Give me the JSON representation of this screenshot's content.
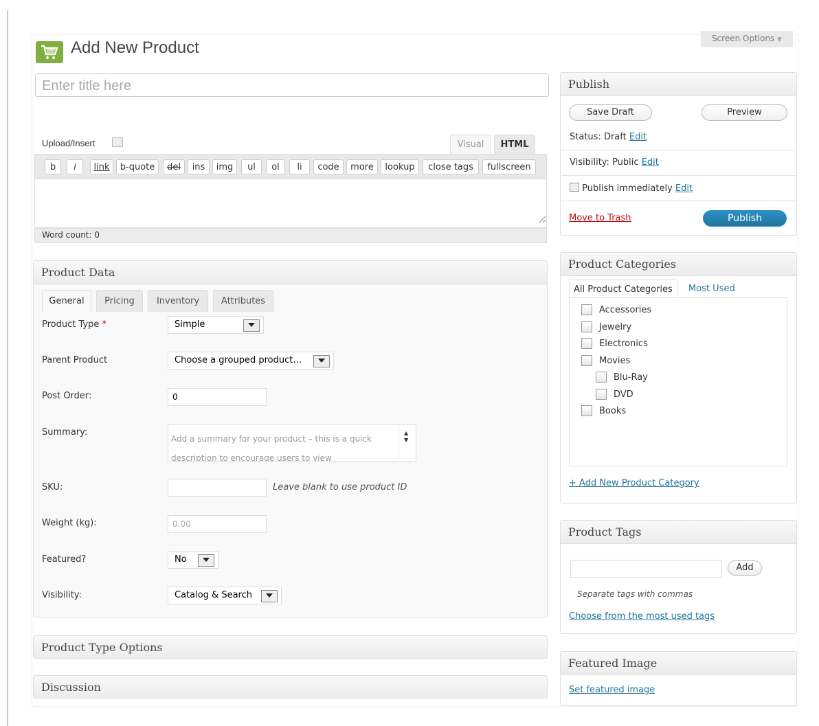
{
  "screen_options": "Screen Options",
  "page_title": "Add New Product",
  "title_placeholder": "Enter title here",
  "editor": {
    "upload_insert": "Upload/Insert",
    "tab_visual": "Visual",
    "tab_html": "HTML",
    "quicktags": [
      "b",
      "i",
      "link",
      "b-quote",
      "del",
      "ins",
      "img",
      "ul",
      "ol",
      "li",
      "code",
      "more",
      "lookup",
      "close tags",
      "fullscreen"
    ],
    "word_count": "Word count: 0"
  },
  "product_data": {
    "title": "Product Data",
    "tabs": [
      "General",
      "Pricing",
      "Inventory",
      "Attributes"
    ],
    "fields": {
      "product_type_label": "Product Type",
      "required_mark": "*",
      "product_type_value": "Simple",
      "parent_product_label": "Parent Product",
      "parent_product_value": "Choose a grouped product…",
      "post_order_label": "Post Order:",
      "post_order_value": "0",
      "summary_label": "Summary:",
      "summary_placeholder": "Add a summary for your product – this is a quick description to encourage users to view",
      "sku_label": "SKU:",
      "sku_value": "",
      "sku_hint": "Leave blank to use product ID",
      "weight_label": "Weight (kg):",
      "weight_placeholder": "0.00",
      "featured_label": "Featured?",
      "featured_value": "No",
      "visibility_label": "Visibility:",
      "visibility_value": "Catalog & Search"
    }
  },
  "product_type_options": "Product Type Options",
  "discussion": "Discussion",
  "publish": {
    "title": "Publish",
    "save_draft": "Save Draft",
    "preview": "Preview",
    "status_label": "Status:",
    "status_value": "Draft",
    "visibility_label": "Visibility:",
    "visibility_value": "Public",
    "schedule_text": "Publish immediately",
    "edit": "Edit",
    "trash": "Move to Trash",
    "publish_button": "Publish"
  },
  "categories": {
    "title": "Product Categories",
    "tab_all": "All Product Categories",
    "tab_most_used": "Most Used",
    "items": [
      {
        "label": "Accessories",
        "level": 0
      },
      {
        "label": "Jewelry",
        "level": 0
      },
      {
        "label": "Electronics",
        "level": 0
      },
      {
        "label": "Movies",
        "level": 0
      },
      {
        "label": "Blu-Ray",
        "level": 1
      },
      {
        "label": "DVD",
        "level": 1
      },
      {
        "label": "Books",
        "level": 0
      }
    ],
    "add_new": "+ Add New Product Category"
  },
  "tags": {
    "title": "Product Tags",
    "input_value": "",
    "add_button": "Add",
    "hint": "Separate tags with commas",
    "choose_link": "Choose from the most used tags"
  },
  "featured_image": {
    "title": "Featured Image",
    "set_link": "Set featured image"
  },
  "colors": {
    "icon_green": "#7fb03f",
    "link_blue": "#21759b",
    "trash_red": "#bc0b0b",
    "publish_blue": "#21759b"
  }
}
